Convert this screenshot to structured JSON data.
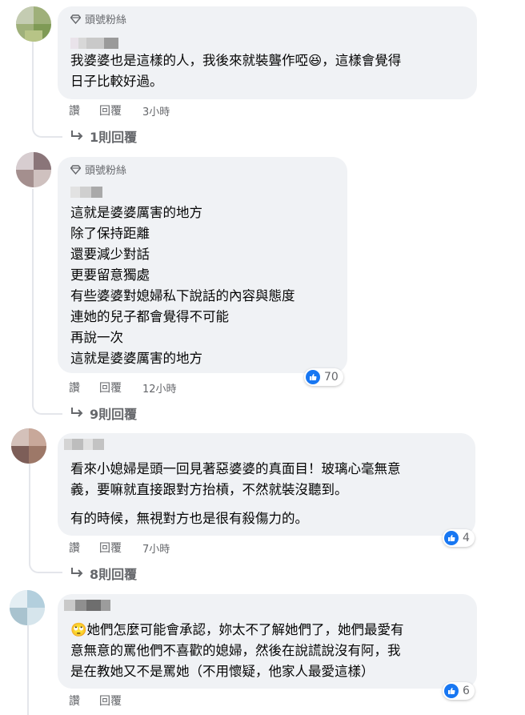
{
  "comments": [
    {
      "badge": "頭號粉絲",
      "lines": [
        "我婆婆也是這樣的人，我後來就裝聾作啞😆，這樣會覺得",
        "日子比較好過。"
      ],
      "actions": {
        "like": "讚",
        "reply": "回覆",
        "time": "3小時"
      },
      "replies": "1則回覆"
    },
    {
      "badge": "頭號粉絲",
      "lines": [
        "這就是婆婆厲害的地方",
        "除了保持距離",
        "還要減少對話",
        "更要留意獨處",
        "有些婆婆對媳婦私下說話的內容與態度",
        "連她的兒子都會覺得不可能",
        "再說一次",
        "這就是婆婆厲害的地方"
      ],
      "reaction_count": "70",
      "actions": {
        "like": "讚",
        "reply": "回覆",
        "time": "12小時"
      },
      "replies": "9則回覆"
    },
    {
      "lines": [
        "看來小媳婦是頭一回見著惡婆婆的真面目！玻璃心毫無意",
        "義，要嘛就直接跟對方抬槓，不然就裝沒聽到。"
      ],
      "lines2": [
        "有的時候，無視對方也是很有殺傷力的。"
      ],
      "reaction_count": "4",
      "actions": {
        "like": "讚",
        "reply": "回覆",
        "time": "7小時"
      },
      "replies": "8則回覆"
    },
    {
      "lines": [
        "🙄她們怎麼可能會承認，妳太不了解她們了，她們最愛有",
        "意無意的罵他們不喜歡的媳婦，然後在說謊說沒有阿，我",
        "是在教她又不是罵她（不用懷疑，他家人最愛這樣）"
      ],
      "reaction_count": "6",
      "actions": {
        "like": "讚",
        "reply": "回覆"
      }
    }
  ],
  "icons": {
    "badge": "diamond-icon",
    "reply_arrow": "reply-arrow-icon",
    "like": "like-icon"
  },
  "colors": {
    "bubble": "#f0f2f5",
    "secondary_text": "#65676b",
    "like_blue": "#1877f2"
  }
}
